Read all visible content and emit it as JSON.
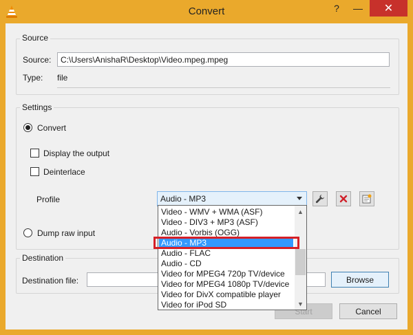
{
  "window": {
    "title": "Convert",
    "help_label": "?",
    "minimize_label": "—",
    "close_label": "✕",
    "accent": "#eaa92c",
    "close_color": "#c7312b"
  },
  "source": {
    "group_label": "Source",
    "source_label": "Source:",
    "source_value": "C:\\Users\\AnishaR\\Desktop\\Video.mpeg.mpeg",
    "type_label": "Type:",
    "type_value": "file"
  },
  "settings": {
    "group_label": "Settings",
    "convert_label": "Convert",
    "convert_selected": true,
    "display_output_label": "Display the output",
    "deinterlace_label": "Deinterlace",
    "profile_label": "Profile",
    "profile_value": "Audio - MP3",
    "dump_raw_label": "Dump raw input"
  },
  "profile_options": [
    "Video - WMV + WMA (ASF)",
    "Video - DIV3 + MP3 (ASF)",
    "Audio - Vorbis (OGG)",
    "Audio - MP3",
    "Audio - FLAC",
    "Audio - CD",
    "Video for MPEG4 720p TV/device",
    "Video for MPEG4 1080p TV/device",
    "Video for DivX compatible player",
    "Video for iPod SD"
  ],
  "selected_option_index": 3,
  "destination": {
    "group_label": "Destination",
    "file_label": "Destination file:",
    "file_value": "",
    "browse_label": "Browse"
  },
  "footer": {
    "start_label": "Start",
    "cancel_label": "Cancel"
  },
  "icons": {
    "edit_profile": "wrench-icon",
    "delete_profile": "red-x-icon",
    "new_profile": "new-profile-icon"
  }
}
